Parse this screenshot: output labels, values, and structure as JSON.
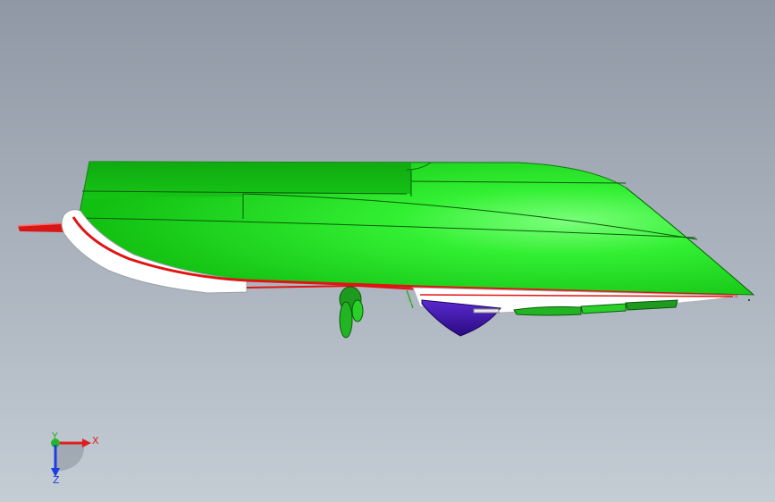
{
  "viewport": {
    "background_top": "#8f98a4",
    "background_bottom": "#c4ccd4"
  },
  "model": {
    "hull_color": "#22ee22",
    "hull_shadow_color": "#11b811",
    "trim_color": "#ffffff",
    "stripe_color": "#e01414",
    "keel_color": "#3a12a8",
    "appendage_color": "#1e9a1e"
  },
  "triad": {
    "x_label": "X",
    "y_label": "Y",
    "z_label": "Z",
    "x_color": "#e01e1e",
    "y_color": "#28b428",
    "z_color": "#1e3ce0"
  }
}
